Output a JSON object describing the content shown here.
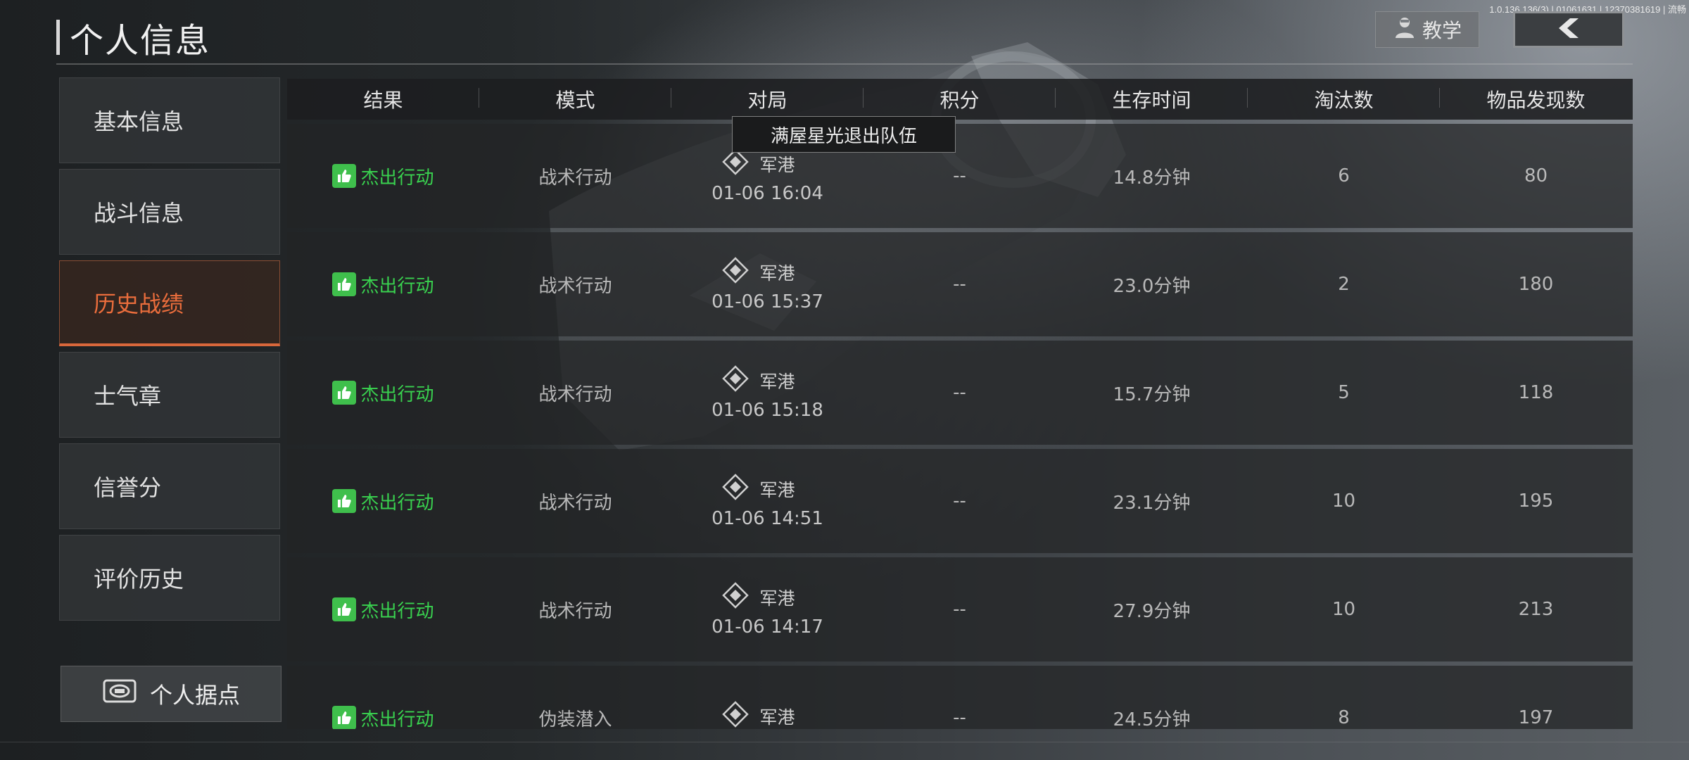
{
  "version": "1.0.136.136(3) | 01061631 | 12370381619 | 流畅",
  "header": {
    "title": "个人信息",
    "teach_label": "教学",
    "teach_icon": "person-icon",
    "back_icon": "chevron-left-icon"
  },
  "sidebar": {
    "items": [
      {
        "label": "基本信息",
        "active": false
      },
      {
        "label": "战斗信息",
        "active": false
      },
      {
        "label": "历史战绩",
        "active": true
      },
      {
        "label": "士气章",
        "active": false
      },
      {
        "label": "信誉分",
        "active": false
      },
      {
        "label": "评价历史",
        "active": false
      }
    ],
    "base_label": "个人据点",
    "base_icon": "base-icon"
  },
  "table": {
    "columns": [
      "结果",
      "模式",
      "对局",
      "积分",
      "生存时间",
      "淘汰数",
      "物品发现数"
    ],
    "rows": [
      {
        "result": "杰出行动",
        "mode": "战术行动",
        "map": "军港",
        "time": "01-06 16:04",
        "score": "--",
        "survival": "14.8分钟",
        "kills": "6",
        "items": "80"
      },
      {
        "result": "杰出行动",
        "mode": "战术行动",
        "map": "军港",
        "time": "01-06 15:37",
        "score": "--",
        "survival": "23.0分钟",
        "kills": "2",
        "items": "180"
      },
      {
        "result": "杰出行动",
        "mode": "战术行动",
        "map": "军港",
        "time": "01-06 15:18",
        "score": "--",
        "survival": "15.7分钟",
        "kills": "5",
        "items": "118"
      },
      {
        "result": "杰出行动",
        "mode": "战术行动",
        "map": "军港",
        "time": "01-06 14:51",
        "score": "--",
        "survival": "23.1分钟",
        "kills": "10",
        "items": "195"
      },
      {
        "result": "杰出行动",
        "mode": "战术行动",
        "map": "军港",
        "time": "01-06 14:17",
        "score": "--",
        "survival": "27.9分钟",
        "kills": "10",
        "items": "213"
      },
      {
        "result": "杰出行动",
        "mode": "伪装潜入",
        "map": "军港",
        "time": "",
        "score": "--",
        "survival": "24.5分钟",
        "kills": "8",
        "items": "197"
      }
    ]
  },
  "tooltip": "满屋星光退出队伍",
  "colors": {
    "accent": "#ea6d3c",
    "success": "#39d14f"
  }
}
